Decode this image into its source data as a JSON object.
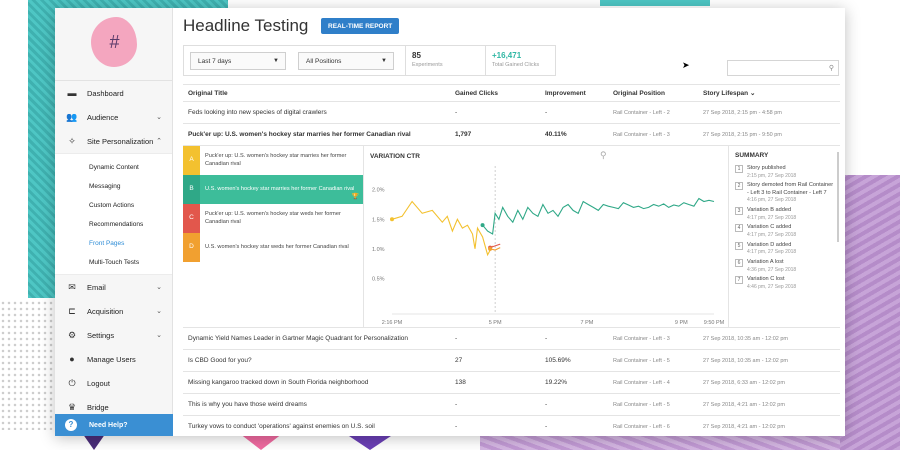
{
  "sidebar": {
    "items": [
      {
        "label": "Dashboard",
        "icon": "dashboard-icon",
        "glyph": "▬",
        "chev": ""
      },
      {
        "label": "Audience",
        "icon": "audience-icon",
        "glyph": "👥",
        "chev": "⌄"
      },
      {
        "label": "Site Personalization",
        "icon": "magic-wand-icon",
        "glyph": "✧",
        "chev": "⌃"
      }
    ],
    "sub_items": [
      "Dynamic Content",
      "Messaging",
      "Custom Actions",
      "Recommendations",
      "Front Pages",
      "Multi-Touch Tests"
    ],
    "active_sub": "Front Pages",
    "items_after": [
      {
        "label": "Email",
        "icon": "email-icon",
        "glyph": "✉",
        "chev": "⌄"
      },
      {
        "label": "Acquisition",
        "icon": "acquisition-icon",
        "glyph": "⊏",
        "chev": "⌄"
      },
      {
        "label": "Settings",
        "icon": "settings-icon",
        "glyph": "⚙",
        "chev": "⌄"
      },
      {
        "label": "Manage Users",
        "icon": "user-icon",
        "glyph": "●",
        "chev": ""
      },
      {
        "label": "Logout",
        "icon": "logout-icon",
        "glyph": "⏻",
        "chev": ""
      },
      {
        "label": "Bridge",
        "icon": "crown-icon",
        "glyph": "♛",
        "chev": ""
      }
    ],
    "help_label": "Need Help?",
    "logo_glyph": "#"
  },
  "header": {
    "title": "Headline Testing",
    "realtime_button": "REAL-TIME REPORT"
  },
  "filters": {
    "date_range": "Last 7 days",
    "position": "All Positions",
    "experiments_value": "85",
    "experiments_label": "Experiments",
    "clicks_value": "+16,471",
    "clicks_label": "Total Gained Clicks"
  },
  "search": {
    "placeholder": ""
  },
  "table": {
    "headers": [
      "Original Title",
      "Gained Clicks",
      "Improvement",
      "Original Position",
      "Story Lifespan ⌄"
    ],
    "rows_before": [
      {
        "title": "Feds looking into new species of digital crawlers",
        "clicks": "-",
        "improvement": "-",
        "position": "Rail Container - Left - 2",
        "lifespan": "27 Sep 2018, 2:15 pm - 4:58 pm",
        "bold": false
      },
      {
        "title": "Puck'er up: U.S. women's hockey star marries her former Canadian rival",
        "clicks": "1,797",
        "improvement": "40.11%",
        "position": "Rail Container - Left - 3",
        "lifespan": "27 Sep 2018, 2:15 pm - 9:50 pm",
        "bold": true
      }
    ],
    "rows_after": [
      {
        "title": "Dynamic Yield Names Leader in Gartner Magic Quadrant for Personalization",
        "clicks": "-",
        "improvement": "-",
        "position": "Rail Container - Left - 3",
        "lifespan": "27 Sep 2018, 10:35 am - 12:02 pm"
      },
      {
        "title": "Is CBD Good for you?",
        "clicks": "27",
        "improvement": "105.69%",
        "position": "Rail Container - Left - 5",
        "lifespan": "27 Sep 2018, 10:35 am - 12:02 pm"
      },
      {
        "title": "Missing kangaroo tracked down in South Florida neighborhood",
        "clicks": "138",
        "improvement": "19.22%",
        "position": "Rail Container - Left - 4",
        "lifespan": "27 Sep 2018, 6:33 am - 12:02 pm"
      },
      {
        "title": "This is why you have those weird dreams",
        "clicks": "-",
        "improvement": "-",
        "position": "Rail Container - Left - 5",
        "lifespan": "27 Sep 2018, 4:21 am - 12:02 pm"
      },
      {
        "title": "Turkey vows to conduct 'operations' against enemies on U.S. soil",
        "clicks": "-",
        "improvement": "-",
        "position": "Rail Container - Left - 6",
        "lifespan": "27 Sep 2018, 4:21 am - 12:02 pm"
      }
    ]
  },
  "variations": [
    {
      "letter": "A",
      "text": "Puck'er up: U.S. women's hockey star marries her former Canadian rival",
      "color": "#f3c12f",
      "winner": false
    },
    {
      "letter": "B",
      "text": "U.S. women's hockey star marries her former Canadian rival",
      "color": "#2fa887",
      "winner": true
    },
    {
      "letter": "C",
      "text": "Puck'er up: U.S. women's hockey star weds her former Canadian rival",
      "color": "#e2574c",
      "winner": false
    },
    {
      "letter": "D",
      "text": "U.S. women's hockey star weds her former Canadian rival",
      "color": "#f1a030",
      "winner": false
    }
  ],
  "chart_data": {
    "type": "line",
    "title": "VARIATION CTR",
    "y_ticks": [
      "2.0%",
      "1.5%",
      "1.0%",
      "0.5%"
    ],
    "x_ticks": [
      "2:16 PM",
      "5 PM",
      "7 PM",
      "9 PM",
      "9:50 PM"
    ],
    "ylim": [
      0,
      2.4
    ],
    "colors": {
      "A": "#f3c12f",
      "B": "#2fa887",
      "C": "#e2574c",
      "D": "#f1a030"
    },
    "series": [
      {
        "name": "A",
        "x": [
          0,
          0.08,
          0.16,
          0.24,
          0.32,
          0.4,
          0.44,
          0.48,
          0.52,
          0.56,
          0.6,
          0.64,
          0.66,
          0.68,
          0.72,
          0.76,
          0.8
        ],
        "y": [
          1.5,
          1.55,
          1.8,
          1.6,
          1.65,
          1.45,
          1.55,
          1.3,
          1.5,
          1.35,
          1.4,
          1.25,
          1.0,
          1.35,
          1.2,
          0.9,
          1.05
        ]
      },
      {
        "name": "B",
        "x": [
          0.72,
          0.76,
          0.8,
          0.82,
          0.85,
          0.88,
          0.92,
          0.96,
          1.0,
          1.04,
          1.08,
          1.12,
          1.16,
          1.2,
          1.24,
          1.28,
          1.32,
          1.36,
          1.4,
          1.44,
          1.48,
          1.52,
          1.56,
          1.6,
          1.64,
          1.68,
          1.72,
          1.76,
          1.8,
          1.84,
          1.88,
          1.92,
          1.96,
          2.0,
          2.04,
          2.08,
          2.12,
          2.16,
          2.2,
          2.24,
          2.28,
          2.32,
          2.36,
          2.4,
          2.44,
          2.48,
          2.52,
          2.56
        ],
        "y": [
          1.4,
          1.3,
          1.25,
          1.6,
          1.5,
          1.7,
          1.55,
          1.45,
          1.65,
          1.5,
          1.7,
          1.6,
          1.55,
          1.75,
          1.6,
          1.65,
          1.55,
          1.7,
          1.75,
          1.65,
          1.6,
          1.8,
          1.75,
          1.7,
          1.65,
          1.75,
          1.72,
          1.7,
          1.68,
          1.78,
          1.74,
          1.7,
          1.72,
          1.68,
          1.7,
          1.75,
          1.72,
          1.76,
          1.7,
          1.74,
          1.72,
          1.78,
          1.75,
          1.72,
          1.85,
          1.8,
          1.82,
          1.8
        ]
      },
      {
        "name": "C",
        "x": [
          0.78,
          0.82,
          0.86
        ],
        "y": [
          1.02,
          1.05,
          1.08
        ]
      },
      {
        "name": "D",
        "x": [
          0.78,
          0.82,
          0.86
        ],
        "y": [
          1.0,
          0.98,
          1.02
        ]
      }
    ]
  },
  "summary": {
    "title": "SUMMARY",
    "events": [
      {
        "n": "1",
        "text": "Story published",
        "date": "2:15 pm, 27 Sep 2018"
      },
      {
        "n": "2",
        "text": "Story demoted from Rail Container - Left 3 to Rail Container - Left 7",
        "date": "4:16 pm, 27 Sep 2018"
      },
      {
        "n": "3",
        "text": "Variation B added",
        "date": "4:17 pm, 27 Sep 2018"
      },
      {
        "n": "4",
        "text": "Variation C added",
        "date": "4:17 pm, 27 Sep 2018"
      },
      {
        "n": "5",
        "text": "Variation D added",
        "date": "4:17 pm, 27 Sep 2018"
      },
      {
        "n": "6",
        "text": "Variation A lost",
        "date": "4:36 pm, 27 Sep 2018"
      },
      {
        "n": "7",
        "text": "Variation C lost",
        "date": "4:46 pm, 27 Sep 2018"
      }
    ]
  }
}
